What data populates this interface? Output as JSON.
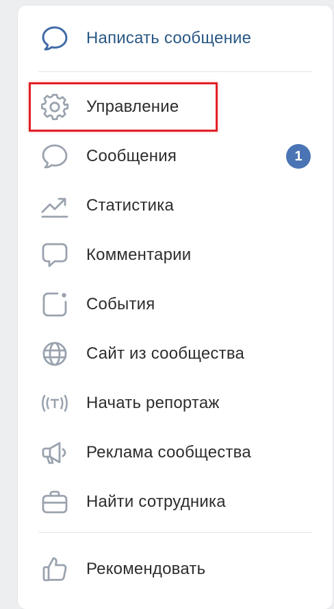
{
  "colors": {
    "accent": "#2a5885",
    "icon": "#99a2ad",
    "icon_primary": "#3f6aa8",
    "badge": "#4b74b5",
    "highlight": "#e11f26"
  },
  "menu": {
    "write_message": {
      "label": "Написать сообщение",
      "icon": "chat-bubble-icon"
    },
    "items": [
      {
        "label": "Управление",
        "icon": "gear-icon"
      },
      {
        "label": "Сообщения",
        "icon": "chat-bubble-icon",
        "badge": "1"
      },
      {
        "label": "Статистика",
        "icon": "trend-chart-icon"
      },
      {
        "label": "Комментарии",
        "icon": "comment-square-icon"
      },
      {
        "label": "События",
        "icon": "event-icon"
      },
      {
        "label": "Сайт из сообщества",
        "icon": "globe-icon"
      },
      {
        "label": "Начать репортаж",
        "icon": "broadcast-icon"
      },
      {
        "label": "Реклама сообщества",
        "icon": "megaphone-icon"
      },
      {
        "label": "Найти сотрудника",
        "icon": "briefcase-icon"
      }
    ],
    "recommend": {
      "label": "Рекомендовать",
      "icon": "thumbs-up-icon"
    }
  }
}
